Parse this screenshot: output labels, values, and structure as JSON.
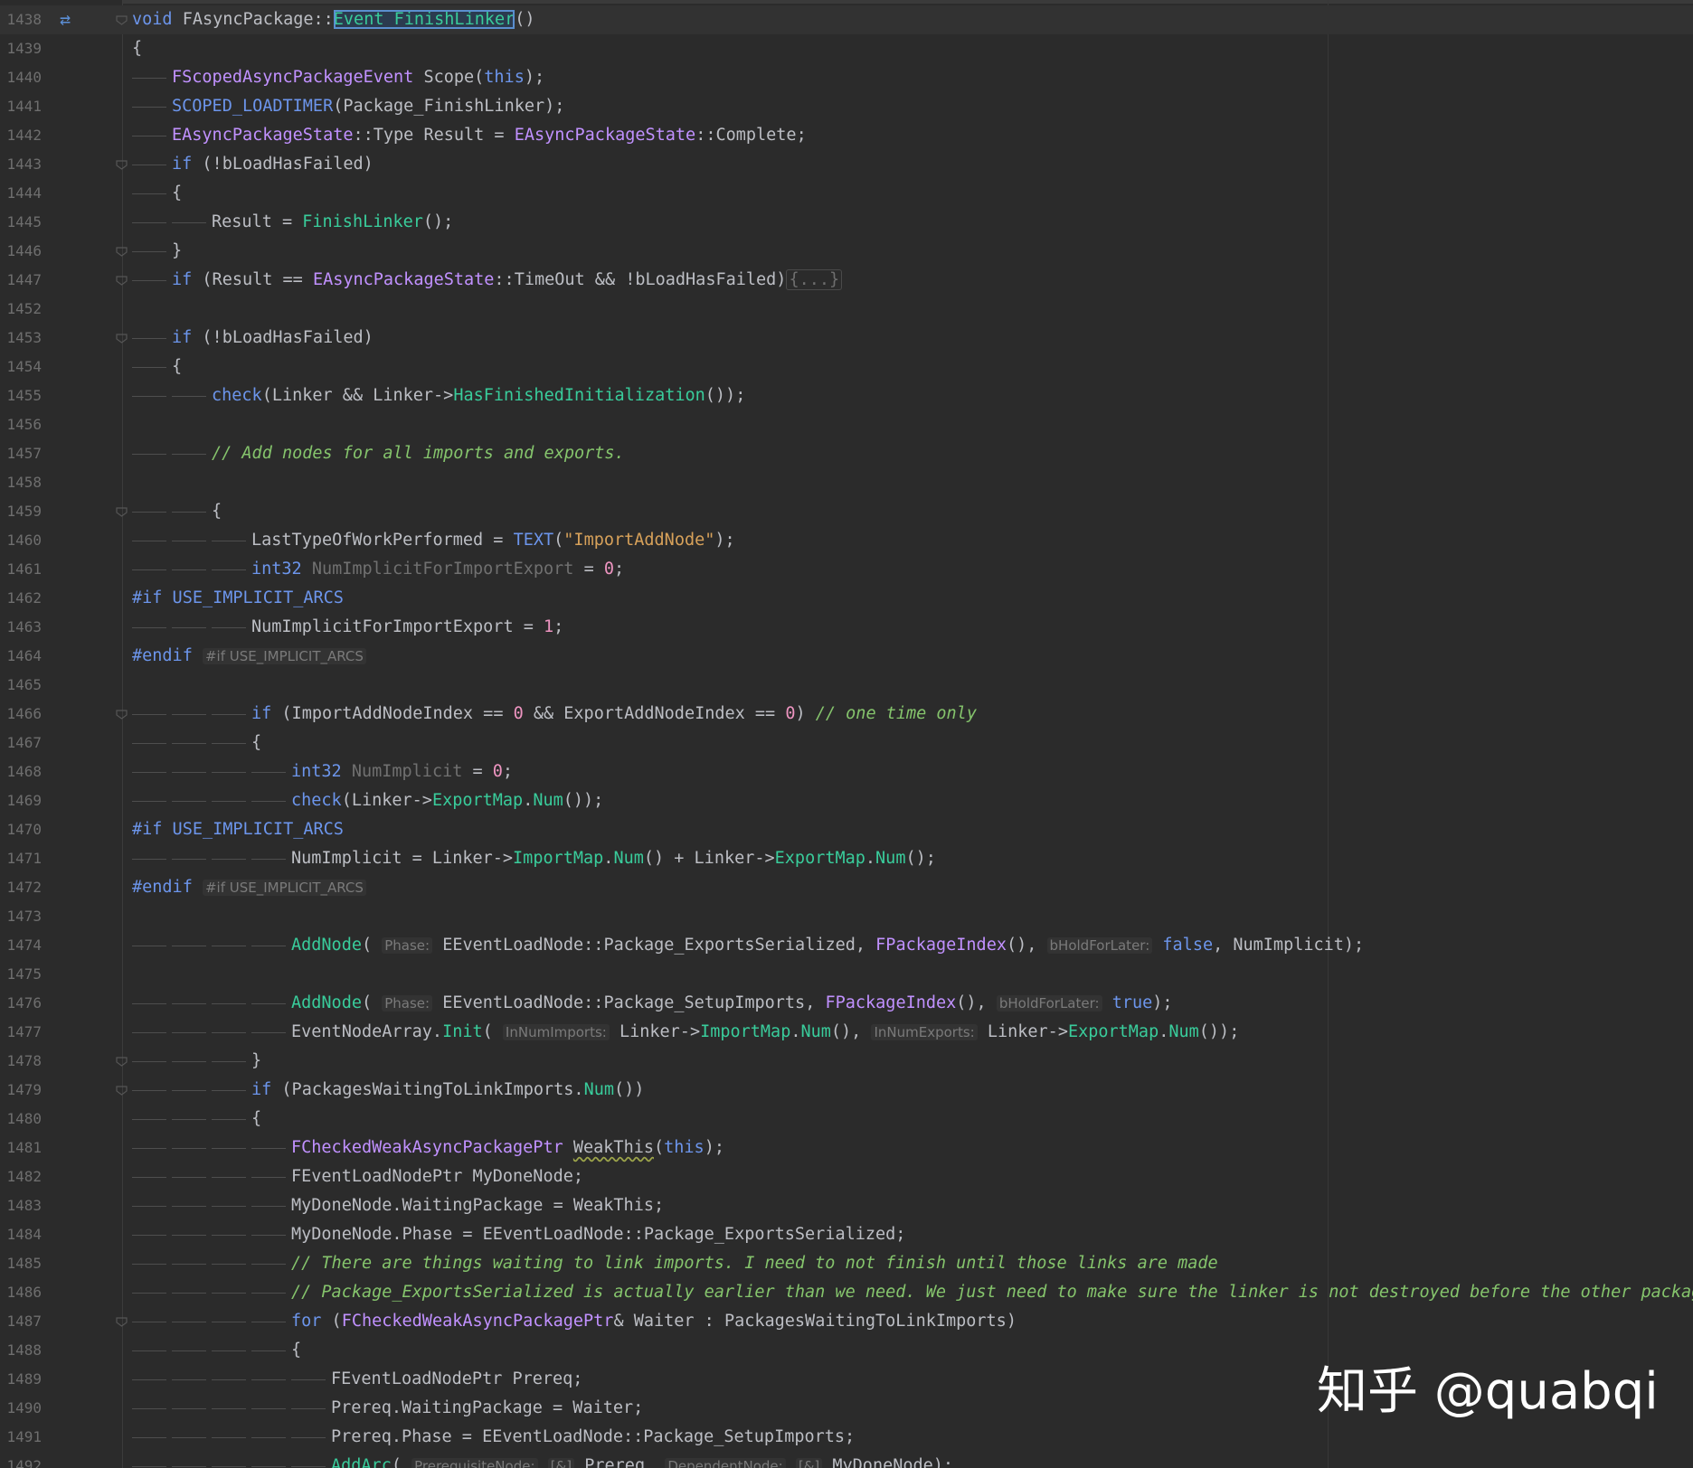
{
  "editor": {
    "colors": {
      "background": "#2b2b2b",
      "keyword": "#6c95eb",
      "function": "#39cc9b",
      "type": "#c191ff",
      "string": "#d7a15a",
      "number": "#ed94c0",
      "comment": "#85c46c",
      "text": "#bcbec4",
      "line_number": "#6e6e6e"
    },
    "gutter_icon": "swap-arrows-icon",
    "lines": [
      {
        "n": "1438",
        "indent": 0,
        "fold": true,
        "icon": true,
        "current": true,
        "tokens": [
          [
            "kw",
            "void "
          ],
          [
            "var",
            "FAsyncPackage::"
          ],
          [
            "fn hl",
            "Event_FinishLinker"
          ],
          [
            "op",
            "()"
          ]
        ]
      },
      {
        "n": "1439",
        "indent": 0,
        "tokens": [
          [
            "op",
            "{"
          ]
        ]
      },
      {
        "n": "1440",
        "indent": 1,
        "tokens": [
          [
            "type",
            "FScopedAsyncPackageEvent"
          ],
          [
            "var",
            " Scope"
          ],
          [
            "op",
            "("
          ],
          [
            "kw",
            "this"
          ],
          [
            "op",
            ");"
          ]
        ]
      },
      {
        "n": "1441",
        "indent": 1,
        "tokens": [
          [
            "macro",
            "SCOPED_LOADTIMER"
          ],
          [
            "op",
            "(Package_FinishLinker);"
          ]
        ]
      },
      {
        "n": "1442",
        "indent": 1,
        "tokens": [
          [
            "type",
            "EAsyncPackageState"
          ],
          [
            "op",
            "::"
          ],
          [
            "var",
            "Type Result = "
          ],
          [
            "type",
            "EAsyncPackageState"
          ],
          [
            "op",
            "::"
          ],
          [
            "var",
            "Complete;"
          ]
        ]
      },
      {
        "n": "1443",
        "indent": 1,
        "fold": true,
        "tokens": [
          [
            "kw",
            "if"
          ],
          [
            "op",
            " (!bLoadHasFailed)"
          ]
        ]
      },
      {
        "n": "1444",
        "indent": 1,
        "tokens": [
          [
            "op",
            "{"
          ]
        ]
      },
      {
        "n": "1445",
        "indent": 2,
        "tokens": [
          [
            "var",
            "Result = "
          ],
          [
            "fn",
            "FinishLinker"
          ],
          [
            "op",
            "();"
          ]
        ]
      },
      {
        "n": "1446",
        "indent": 1,
        "fold": true,
        "tokens": [
          [
            "op",
            "}"
          ]
        ]
      },
      {
        "n": "1447",
        "indent": 1,
        "fold": true,
        "tokens": [
          [
            "kw",
            "if"
          ],
          [
            "op",
            " (Result == "
          ],
          [
            "type",
            "EAsyncPackageState"
          ],
          [
            "op",
            "::"
          ],
          [
            "var",
            "TimeOut && !bLoadHasFailed)"
          ],
          [
            "collapsed",
            "{...}"
          ]
        ]
      },
      {
        "n": "1452",
        "indent": 0,
        "tokens": []
      },
      {
        "n": "1453",
        "indent": 1,
        "fold": true,
        "tokens": [
          [
            "kw",
            "if"
          ],
          [
            "op",
            " (!bLoadHasFailed)"
          ]
        ]
      },
      {
        "n": "1454",
        "indent": 1,
        "tokens": [
          [
            "op",
            "{"
          ]
        ]
      },
      {
        "n": "1455",
        "indent": 2,
        "tokens": [
          [
            "macro",
            "check"
          ],
          [
            "op",
            "(Linker && Linker->"
          ],
          [
            "fn",
            "HasFinishedInitialization"
          ],
          [
            "op",
            "());"
          ]
        ]
      },
      {
        "n": "1456",
        "indent": 0,
        "tokens": []
      },
      {
        "n": "1457",
        "indent": 2,
        "tokens": [
          [
            "cm",
            "// Add nodes for all imports and exports."
          ]
        ]
      },
      {
        "n": "1458",
        "indent": 0,
        "tokens": []
      },
      {
        "n": "1459",
        "indent": 2,
        "fold": true,
        "tokens": [
          [
            "op",
            "{"
          ]
        ]
      },
      {
        "n": "1460",
        "indent": 3,
        "tokens": [
          [
            "var",
            "LastTypeOfWorkPerformed = "
          ],
          [
            "macro",
            "TEXT"
          ],
          [
            "op",
            "("
          ],
          [
            "str",
            "\"ImportAddNode\""
          ],
          [
            "op",
            ");"
          ]
        ]
      },
      {
        "n": "1461",
        "indent": 3,
        "tokens": [
          [
            "kw",
            "int32"
          ],
          [
            "faded",
            " NumImplicitForImportExport"
          ],
          [
            "op",
            " = "
          ],
          [
            "num",
            "0"
          ],
          [
            "op",
            ";"
          ]
        ]
      },
      {
        "n": "1462",
        "indent": 0,
        "tokens": [
          [
            "pp",
            "#if USE_IMPLICIT_ARCS"
          ]
        ]
      },
      {
        "n": "1463",
        "indent": 3,
        "tokens": [
          [
            "var",
            "NumImplicitForImportExport = "
          ],
          [
            "num",
            "1"
          ],
          [
            "op",
            ";"
          ]
        ]
      },
      {
        "n": "1464",
        "indent": 0,
        "tokens": [
          [
            "pp",
            "#endif"
          ],
          [
            "op",
            " "
          ],
          [
            "hint",
            "#if USE_IMPLICIT_ARCS"
          ]
        ]
      },
      {
        "n": "1465",
        "indent": 0,
        "tokens": []
      },
      {
        "n": "1466",
        "indent": 3,
        "fold": true,
        "tokens": [
          [
            "kw",
            "if"
          ],
          [
            "op",
            " (ImportAddNodeIndex == "
          ],
          [
            "num",
            "0"
          ],
          [
            "op",
            " && ExportAddNodeIndex == "
          ],
          [
            "num",
            "0"
          ],
          [
            "op",
            ") "
          ],
          [
            "cm",
            "// one time only"
          ]
        ]
      },
      {
        "n": "1467",
        "indent": 3,
        "tokens": [
          [
            "op",
            "{"
          ]
        ]
      },
      {
        "n": "1468",
        "indent": 4,
        "tokens": [
          [
            "kw",
            "int32"
          ],
          [
            "faded",
            " NumImplicit"
          ],
          [
            "op",
            " = "
          ],
          [
            "num",
            "0"
          ],
          [
            "op",
            ";"
          ]
        ]
      },
      {
        "n": "1469",
        "indent": 4,
        "tokens": [
          [
            "macro",
            "check"
          ],
          [
            "op",
            "(Linker->"
          ],
          [
            "fn",
            "ExportMap"
          ],
          [
            "op",
            "."
          ],
          [
            "fn",
            "Num"
          ],
          [
            "op",
            "());"
          ]
        ]
      },
      {
        "n": "1470",
        "indent": 0,
        "tokens": [
          [
            "pp",
            "#if USE_IMPLICIT_ARCS"
          ]
        ]
      },
      {
        "n": "1471",
        "indent": 4,
        "tokens": [
          [
            "var",
            "NumImplicit = Linker->"
          ],
          [
            "fn",
            "ImportMap"
          ],
          [
            "op",
            "."
          ],
          [
            "fn",
            "Num"
          ],
          [
            "op",
            "() + Linker->"
          ],
          [
            "fn",
            "ExportMap"
          ],
          [
            "op",
            "."
          ],
          [
            "fn",
            "Num"
          ],
          [
            "op",
            "();"
          ]
        ]
      },
      {
        "n": "1472",
        "indent": 0,
        "tokens": [
          [
            "pp",
            "#endif"
          ],
          [
            "op",
            " "
          ],
          [
            "hint",
            "#if USE_IMPLICIT_ARCS"
          ]
        ]
      },
      {
        "n": "1473",
        "indent": 0,
        "tokens": []
      },
      {
        "n": "1474",
        "indent": 4,
        "tokens": [
          [
            "fn",
            "AddNode"
          ],
          [
            "op",
            "( "
          ],
          [
            "hint",
            "Phase:"
          ],
          [
            "op",
            " EEventLoadNode::Package_ExportsSerialized, "
          ],
          [
            "type",
            "FPackageIndex"
          ],
          [
            "op",
            "(), "
          ],
          [
            "hint",
            "bHoldForLater:"
          ],
          [
            "op",
            " "
          ],
          [
            "kw",
            "false"
          ],
          [
            "op",
            ", NumImplicit);"
          ]
        ]
      },
      {
        "n": "1475",
        "indent": 0,
        "tokens": []
      },
      {
        "n": "1476",
        "indent": 4,
        "tokens": [
          [
            "fn",
            "AddNode"
          ],
          [
            "op",
            "( "
          ],
          [
            "hint",
            "Phase:"
          ],
          [
            "op",
            " EEventLoadNode::Package_SetupImports, "
          ],
          [
            "type",
            "FPackageIndex"
          ],
          [
            "op",
            "(), "
          ],
          [
            "hint",
            "bHoldForLater:"
          ],
          [
            "op",
            " "
          ],
          [
            "kw",
            "true"
          ],
          [
            "op",
            ");"
          ]
        ]
      },
      {
        "n": "1477",
        "indent": 4,
        "tokens": [
          [
            "var",
            "EventNodeArray."
          ],
          [
            "fn",
            "Init"
          ],
          [
            "op",
            "( "
          ],
          [
            "hint",
            "InNumImports:"
          ],
          [
            "op",
            " Linker->"
          ],
          [
            "fn",
            "ImportMap"
          ],
          [
            "op",
            "."
          ],
          [
            "fn",
            "Num"
          ],
          [
            "op",
            "(), "
          ],
          [
            "hint",
            "InNumExports:"
          ],
          [
            "op",
            " Linker->"
          ],
          [
            "fn",
            "ExportMap"
          ],
          [
            "op",
            "."
          ],
          [
            "fn",
            "Num"
          ],
          [
            "op",
            "());"
          ]
        ]
      },
      {
        "n": "1478",
        "indent": 3,
        "fold": true,
        "tokens": [
          [
            "op",
            "}"
          ]
        ]
      },
      {
        "n": "1479",
        "indent": 3,
        "fold": true,
        "tokens": [
          [
            "kw",
            "if"
          ],
          [
            "op",
            " (PackagesWaitingToLinkImports."
          ],
          [
            "fn",
            "Num"
          ],
          [
            "op",
            "())"
          ]
        ]
      },
      {
        "n": "1480",
        "indent": 3,
        "tokens": [
          [
            "op",
            "{"
          ]
        ]
      },
      {
        "n": "1481",
        "indent": 4,
        "tokens": [
          [
            "type",
            "FCheckedWeakAsyncPackagePtr"
          ],
          [
            "op",
            " "
          ],
          [
            "wavy",
            "WeakThis"
          ],
          [
            "op",
            "("
          ],
          [
            "kw",
            "this"
          ],
          [
            "op",
            ");"
          ]
        ]
      },
      {
        "n": "1482",
        "indent": 4,
        "tokens": [
          [
            "var",
            "FEventLoadNodePtr MyDoneNode;"
          ]
        ]
      },
      {
        "n": "1483",
        "indent": 4,
        "tokens": [
          [
            "var",
            "MyDoneNode.WaitingPackage = WeakThis;"
          ]
        ]
      },
      {
        "n": "1484",
        "indent": 4,
        "tokens": [
          [
            "var",
            "MyDoneNode.Phase = EEventLoadNode::Package_ExportsSerialized;"
          ]
        ]
      },
      {
        "n": "1485",
        "indent": 4,
        "tokens": [
          [
            "cm",
            "// There are things waiting to link imports. I need to not finish until those links are made"
          ]
        ]
      },
      {
        "n": "1486",
        "indent": 4,
        "tokens": [
          [
            "cm",
            "// Package_ExportsSerialized is actually earlier than we need. We just need to make sure the linker is not destroyed before the other package"
          ]
        ]
      },
      {
        "n": "1487",
        "indent": 4,
        "fold": true,
        "tokens": [
          [
            "kw",
            "for"
          ],
          [
            "op",
            " ("
          ],
          [
            "type",
            "FCheckedWeakAsyncPackagePtr"
          ],
          [
            "op",
            "& Waiter : PackagesWaitingToLinkImports)"
          ]
        ]
      },
      {
        "n": "1488",
        "indent": 4,
        "tokens": [
          [
            "op",
            "{"
          ]
        ]
      },
      {
        "n": "1489",
        "indent": 5,
        "tokens": [
          [
            "var",
            "FEventLoadNodePtr Prereq;"
          ]
        ]
      },
      {
        "n": "1490",
        "indent": 5,
        "tokens": [
          [
            "var",
            "Prereq.WaitingPackage = Waiter;"
          ]
        ]
      },
      {
        "n": "1491",
        "indent": 5,
        "tokens": [
          [
            "var",
            "Prereq.Phase = EEventLoadNode::Package_SetupImports;"
          ]
        ]
      },
      {
        "n": "1492",
        "indent": 5,
        "tokens": [
          [
            "fn",
            "AddArc"
          ],
          [
            "op",
            "( "
          ],
          [
            "hint",
            "PrerequisiteNode:"
          ],
          [
            "op",
            " "
          ],
          [
            "hint",
            "[&]"
          ],
          [
            "op",
            " Prereq, "
          ],
          [
            "hint",
            "DependentNode:"
          ],
          [
            "op",
            " "
          ],
          [
            "hint",
            "[&]"
          ],
          [
            "op",
            " MyDoneNode);"
          ]
        ]
      }
    ]
  },
  "watermark": {
    "text": "知乎 @quabqi"
  }
}
